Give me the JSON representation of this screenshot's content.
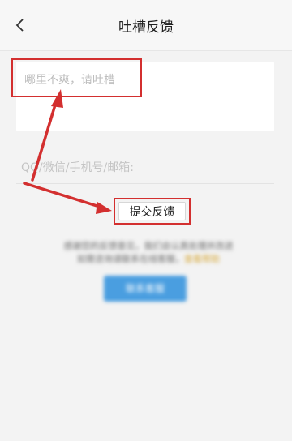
{
  "header": {
    "title": "吐槽反馈",
    "back_icon": "chevron-left-icon"
  },
  "form": {
    "feedback_placeholder": "哪里不爽，请吐槽",
    "contact_placeholder": "QQ/微信/手机号/邮箱:",
    "submit_label": "提交反馈"
  },
  "annotation": {
    "highlight_color": "#d32f2f"
  },
  "blurred_section": {
    "line1": "感谢您的反馈意见，我们会认真处理并改进",
    "line2_text": "如需咨询请联系在线客服，",
    "line2_link": "查看帮助",
    "button_label": "联系客服"
  }
}
